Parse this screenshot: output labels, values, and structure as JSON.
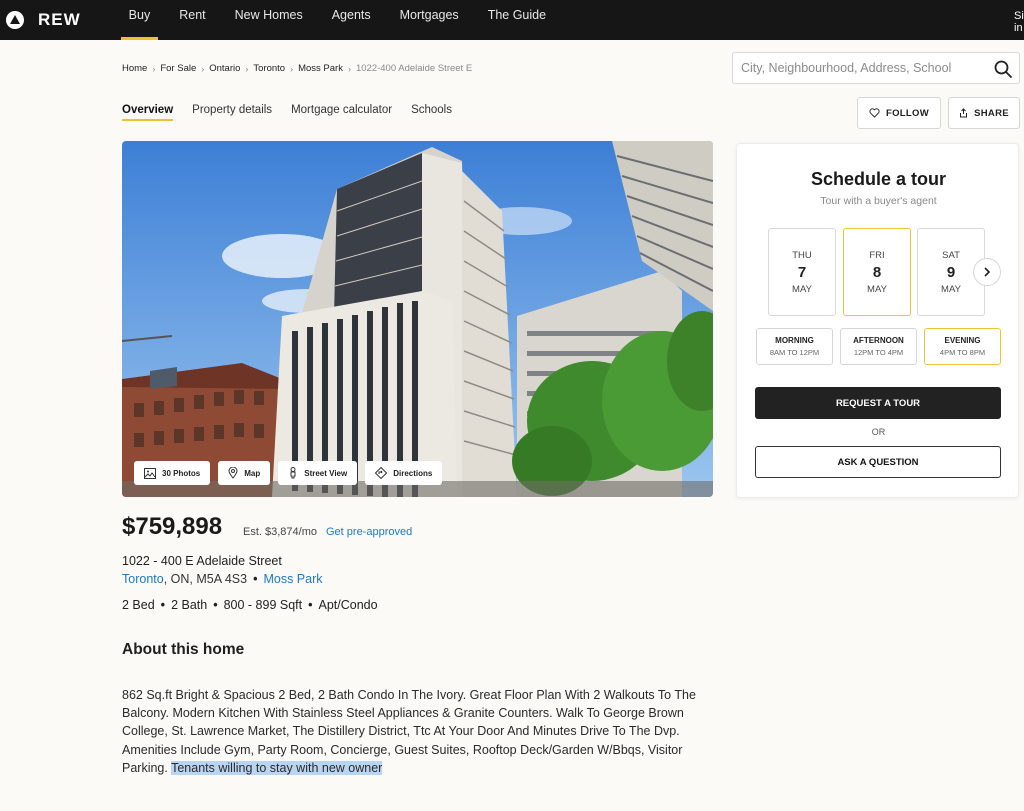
{
  "nav": {
    "logo": "REW",
    "items": [
      "Buy",
      "Rent",
      "New Homes",
      "Agents",
      "Mortgages",
      "The Guide"
    ],
    "signin": "Sign in"
  },
  "breadcrumb": [
    "Home",
    "For Sale",
    "Ontario",
    "Toronto",
    "Moss Park",
    "1022-400 Adelaide Street E"
  ],
  "search": {
    "placeholder": "City, Neighbourhood, Address, School"
  },
  "tabs": [
    "Overview",
    "Property details",
    "Mortgage calculator",
    "Schools"
  ],
  "actions": {
    "follow": "FOLLOW",
    "share": "SHARE"
  },
  "photo_buttons": {
    "photos": "30 Photos",
    "map": "Map",
    "street_view": "Street View",
    "directions": "Directions"
  },
  "listing": {
    "price": "$759,898",
    "est": "Est. $3,874/mo",
    "preapproved": "Get pre-approved",
    "street": "1022 - 400 E Adelaide Street",
    "city": "Toronto",
    "province_postal": ", ON, M5A 4S3",
    "neighbourhood": "Moss Park",
    "beds": "2 Bed",
    "baths": "2 Bath",
    "sqft": "800 - 899 Sqft",
    "type": "Apt/Condo"
  },
  "about": {
    "title": "About this home",
    "text": "862 Sq.ft Bright & Spacious 2 Bed, 2 Bath Condo In The Ivory. Great Floor Plan With 2 Walkouts To The Balcony. Modern Kitchen With Stainless Steel Appliances & Granite Counters. Walk To George Brown College, St. Lawrence Market, The Distillery District, Ttc At Your Door And Minutes Drive To The Dvp. Amenities Include Gym, Party Room, Concierge, Guest Suites, Rooftop Deck/Garden W/Bbqs, Visitor Parking.",
    "highlight": "Tenants willing to stay with new owner"
  },
  "tour": {
    "title": "Schedule a tour",
    "subtitle": "Tour with a buyer's agent",
    "days": [
      {
        "dow": "THU",
        "num": "7",
        "mon": "MAY"
      },
      {
        "dow": "FRI",
        "num": "8",
        "mon": "MAY"
      },
      {
        "dow": "SAT",
        "num": "9",
        "mon": "MAY"
      }
    ],
    "selected_day": "FRI",
    "slots": [
      {
        "name": "MORNING",
        "time": "8AM TO 12PM"
      },
      {
        "name": "AFTERNOON",
        "time": "12PM TO 4PM"
      },
      {
        "name": "EVENING",
        "time": "4PM TO 8PM"
      }
    ],
    "selected_slot": "EVENING",
    "request_label": "REQUEST A TOUR",
    "or": "OR",
    "ask_label": "ASK A QUESTION"
  },
  "colors": {
    "accent": "#f2c02e",
    "link": "#1f78c6",
    "nav_bg": "#161616"
  },
  "icons": [
    "logo-icon",
    "search-icon",
    "heart-icon",
    "share-icon",
    "photos-icon",
    "map-pin-icon",
    "street-view-icon",
    "directions-icon",
    "chevron-right-icon"
  ]
}
